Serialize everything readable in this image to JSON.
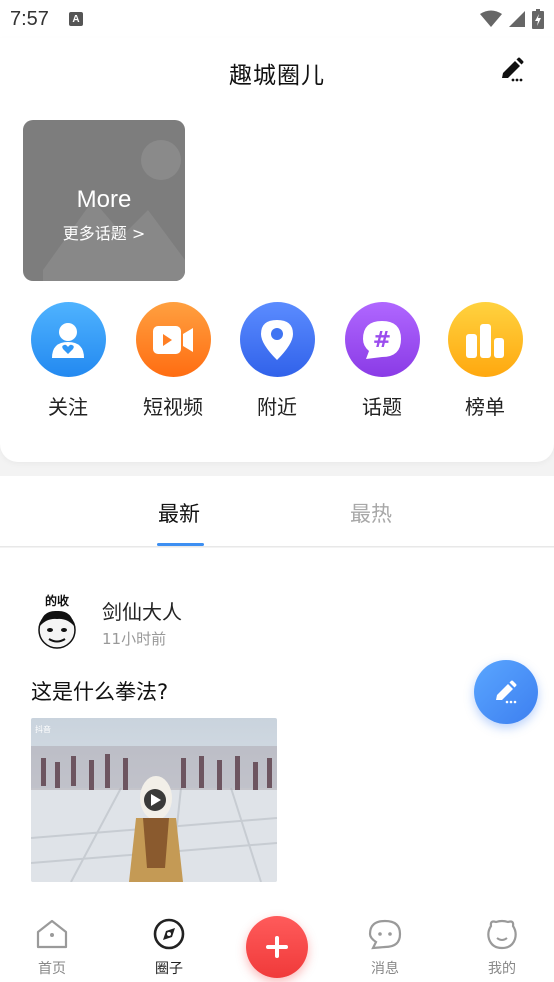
{
  "status_bar": {
    "time": "7:57",
    "notification_icon": "a-icon"
  },
  "header": {
    "title": "趣城圈儿",
    "edit_icon": "pencil-icon"
  },
  "topic_card": {
    "title": "More",
    "subtitle": "更多话题 >"
  },
  "nav": [
    {
      "label": "关注",
      "icon": "follow-user-heart-icon",
      "color": "#2f97f6"
    },
    {
      "label": "短视频",
      "icon": "video-camera-icon",
      "color": "#ff7f24"
    },
    {
      "label": "附近",
      "icon": "location-pin-icon",
      "color": "#3f74f2"
    },
    {
      "label": "话题",
      "icon": "hashtag-chat-icon",
      "color": "#9b4dee"
    },
    {
      "label": "榜单",
      "icon": "bar-chart-icon",
      "color": "#ffbb1c"
    }
  ],
  "tabs": {
    "active": "最新",
    "inactive": "最热"
  },
  "post": {
    "author": "剑仙大人",
    "time": "11小时前",
    "text": "这是什么拳法?",
    "avatar_caption": "的收",
    "video_watermark": "抖音"
  },
  "bottom_nav": [
    {
      "label": "首页",
      "icon": "home-icon",
      "active": false
    },
    {
      "label": "圈子",
      "icon": "compass-icon",
      "active": true
    },
    {
      "label": "消息",
      "icon": "chat-bubble-icon",
      "active": false
    },
    {
      "label": "我的",
      "icon": "profile-face-icon",
      "active": false
    }
  ],
  "colors": {
    "accent": "#3d8ff2",
    "add_button": "#f03a3a",
    "fab": "#3d7ff0"
  }
}
